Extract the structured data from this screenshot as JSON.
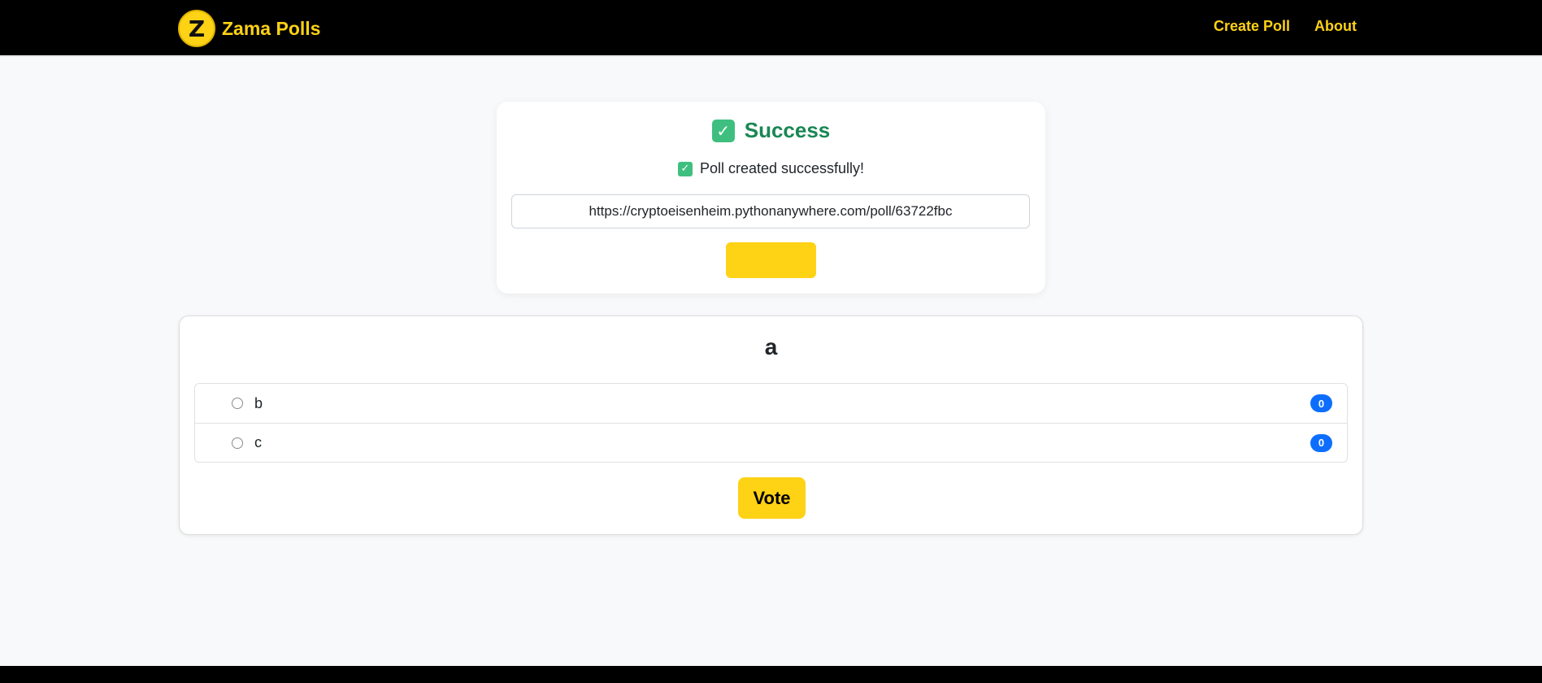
{
  "nav": {
    "brand_name": "Zama Polls",
    "logo_glyph": "Z",
    "links": [
      "Create Poll",
      "About"
    ]
  },
  "success": {
    "icon": "check-mark-icon",
    "heading": "Success",
    "message": "Poll created successfully!",
    "url": "https://cryptoeisenheim.pythonanywhere.com/poll/63722fbc",
    "copy_label": ""
  },
  "poll": {
    "question": "a",
    "options": [
      {
        "label": "b",
        "count": "0"
      },
      {
        "label": "c",
        "count": "0"
      }
    ],
    "vote_label": "Vote"
  },
  "colors": {
    "accent": "#fed215",
    "success": "#198754",
    "badge": "#0d6efd",
    "navbar": "#000000"
  }
}
